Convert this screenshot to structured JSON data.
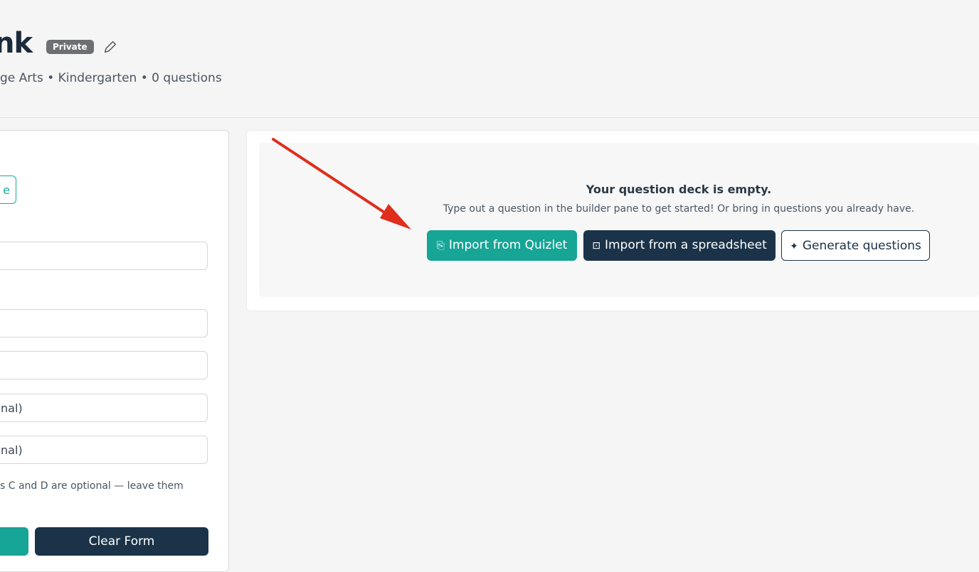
{
  "header": {
    "title": "nk",
    "badge": "Private",
    "meta": "ge Arts • Kindergarten • 0 questions"
  },
  "builder": {
    "mode_button_label": "e",
    "fields": [
      {
        "value": ""
      },
      {
        "value": ""
      },
      {
        "value": ""
      },
      {
        "value": "nal)"
      },
      {
        "value": "nal)"
      }
    ],
    "hint": "s C and D are optional — leave them",
    "clear_label": "Clear Form"
  },
  "empty_state": {
    "title": "Your question deck is empty.",
    "description": "Type out a question in the builder pane to get started! Or bring in questions you already have.",
    "buttons": {
      "quizlet": "Import from Quizlet",
      "spreadsheet": "Import from a spreadsheet",
      "generate": "Generate questions"
    }
  },
  "colors": {
    "teal": "#17a596",
    "navy": "#1b3349",
    "arrow_red": "#e02e1c"
  },
  "icons": {
    "quizlet": "import-icon",
    "spreadsheet": "download-icon",
    "generate": "sparkle-icon",
    "edit": "pencil-icon"
  }
}
